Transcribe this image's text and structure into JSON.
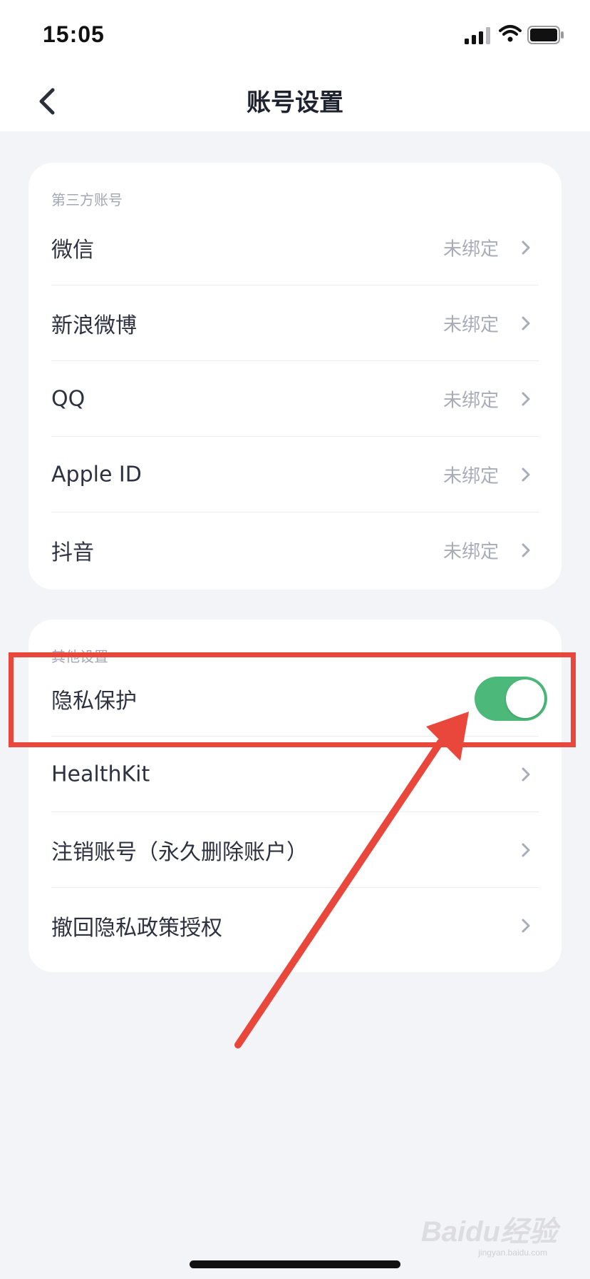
{
  "status_bar": {
    "time": "15:05"
  },
  "nav": {
    "title": "账号设置"
  },
  "third_party": {
    "section_label": "第三方账号",
    "items": [
      {
        "label": "微信",
        "value": "未绑定"
      },
      {
        "label": "新浪微博",
        "value": "未绑定"
      },
      {
        "label": "QQ",
        "value": "未绑定"
      },
      {
        "label": "Apple ID",
        "value": "未绑定"
      },
      {
        "label": "抖音",
        "value": "未绑定"
      }
    ]
  },
  "other": {
    "section_label": "其他设置",
    "privacy": {
      "label": "隐私保护",
      "enabled": true
    },
    "items": [
      {
        "label": "HealthKit"
      },
      {
        "label": "注销账号（永久删除账户）"
      },
      {
        "label": "撤回隐私政策授权"
      }
    ]
  },
  "watermark": {
    "text": "Baidu经验",
    "sub": "jingyan.baidu.com"
  },
  "colors": {
    "accent": "#4cb97a",
    "annotation": "#e9473c",
    "background": "#f3f4f8"
  },
  "icons": [
    "back-arrow-icon",
    "chevron-right-icon",
    "signal-icon",
    "wifi-icon",
    "battery-icon"
  ]
}
